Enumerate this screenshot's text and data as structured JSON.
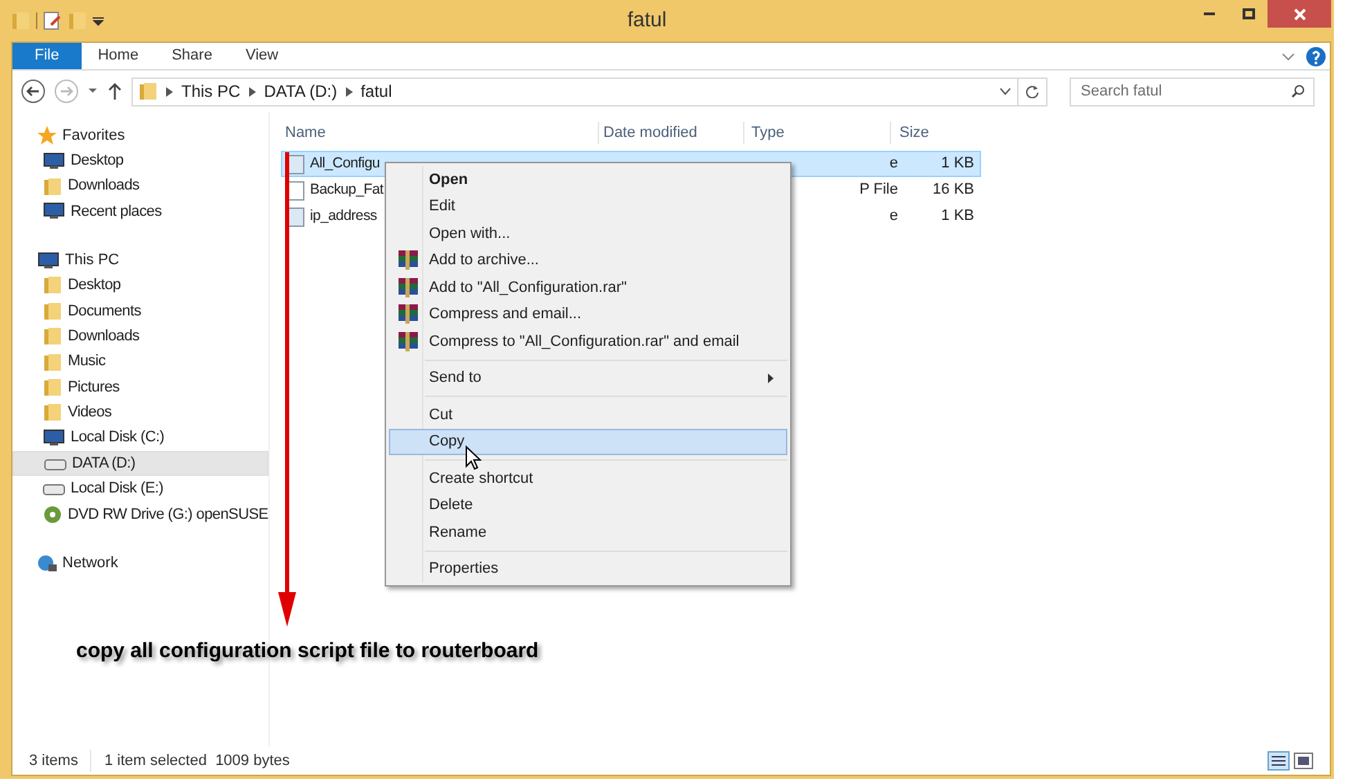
{
  "window": {
    "title": "fatul"
  },
  "ribbon_tabs": [
    {
      "label": "File",
      "selected": true
    },
    {
      "label": "Home",
      "selected": false
    },
    {
      "label": "Share",
      "selected": false
    },
    {
      "label": "View",
      "selected": false
    }
  ],
  "address_bar": {
    "crumbs": [
      "This PC",
      "DATA (D:)",
      "fatul"
    ]
  },
  "search": {
    "placeholder": "Search fatul"
  },
  "sidebar": [
    {
      "label": "Favorites",
      "selected": false,
      "children": [
        {
          "label": "Desktop",
          "selected": false
        },
        {
          "label": "Downloads",
          "selected": false
        },
        {
          "label": "Recent places",
          "selected": false
        }
      ]
    },
    {
      "label": "This PC",
      "selected": false,
      "children": [
        {
          "label": "Desktop",
          "selected": false
        },
        {
          "label": "Documents",
          "selected": false
        },
        {
          "label": "Downloads",
          "selected": false
        },
        {
          "label": "Music",
          "selected": false
        },
        {
          "label": "Pictures",
          "selected": false
        },
        {
          "label": "Videos",
          "selected": false
        },
        {
          "label": "Local Disk (C:)",
          "selected": false
        },
        {
          "label": "DATA (D:)",
          "selected": true
        },
        {
          "label": "Local Disk (E:)",
          "selected": false
        },
        {
          "label": "DVD RW Drive (G:) openSUSE",
          "selected": false
        }
      ]
    },
    {
      "label": "Network",
      "selected": false
    }
  ],
  "table": {
    "columns": [
      "Name",
      "Date modified",
      "Type",
      "Size"
    ],
    "rows": [
      {
        "name": "All_Configu",
        "type": "e",
        "size": "1 KB",
        "selected": true
      },
      {
        "name": "Backup_Fat",
        "type": "P File",
        "size": "16 KB",
        "selected": false
      },
      {
        "name": "ip_address",
        "type": "e",
        "size": "1 KB",
        "selected": false
      }
    ]
  },
  "context_menu": {
    "groups": [
      [
        {
          "label": "Open",
          "kind": "default",
          "selected": false
        },
        {
          "label": "Edit",
          "kind": "plain",
          "selected": false
        },
        {
          "label": "Open with...",
          "kind": "plain",
          "selected": false
        },
        {
          "label": "Add to archive...",
          "kind": "archive",
          "selected": false
        },
        {
          "label": "Add to \"All_Configuration.rar\"",
          "kind": "archive",
          "selected": false
        },
        {
          "label": "Compress and email...",
          "kind": "archive",
          "selected": false
        },
        {
          "label": "Compress to \"All_Configuration.rar\" and email",
          "kind": "archive",
          "selected": false
        }
      ],
      [
        {
          "label": "Send to",
          "kind": "submenu",
          "selected": false
        }
      ],
      [
        {
          "label": "Cut",
          "kind": "plain",
          "selected": false
        },
        {
          "label": "Copy",
          "kind": "plain",
          "selected": true
        }
      ],
      [
        {
          "label": "Create shortcut",
          "kind": "plain",
          "selected": false
        },
        {
          "label": "Delete",
          "kind": "plain",
          "selected": false
        },
        {
          "label": "Rename",
          "kind": "plain",
          "selected": false
        }
      ],
      [
        {
          "label": "Properties",
          "kind": "plain",
          "selected": false
        }
      ]
    ]
  },
  "annotation": {
    "caption": "copy all configuration script file to routerboard"
  },
  "status_bar": {
    "count": "3 items",
    "selection": "1 item selected  1009 bytes"
  }
}
